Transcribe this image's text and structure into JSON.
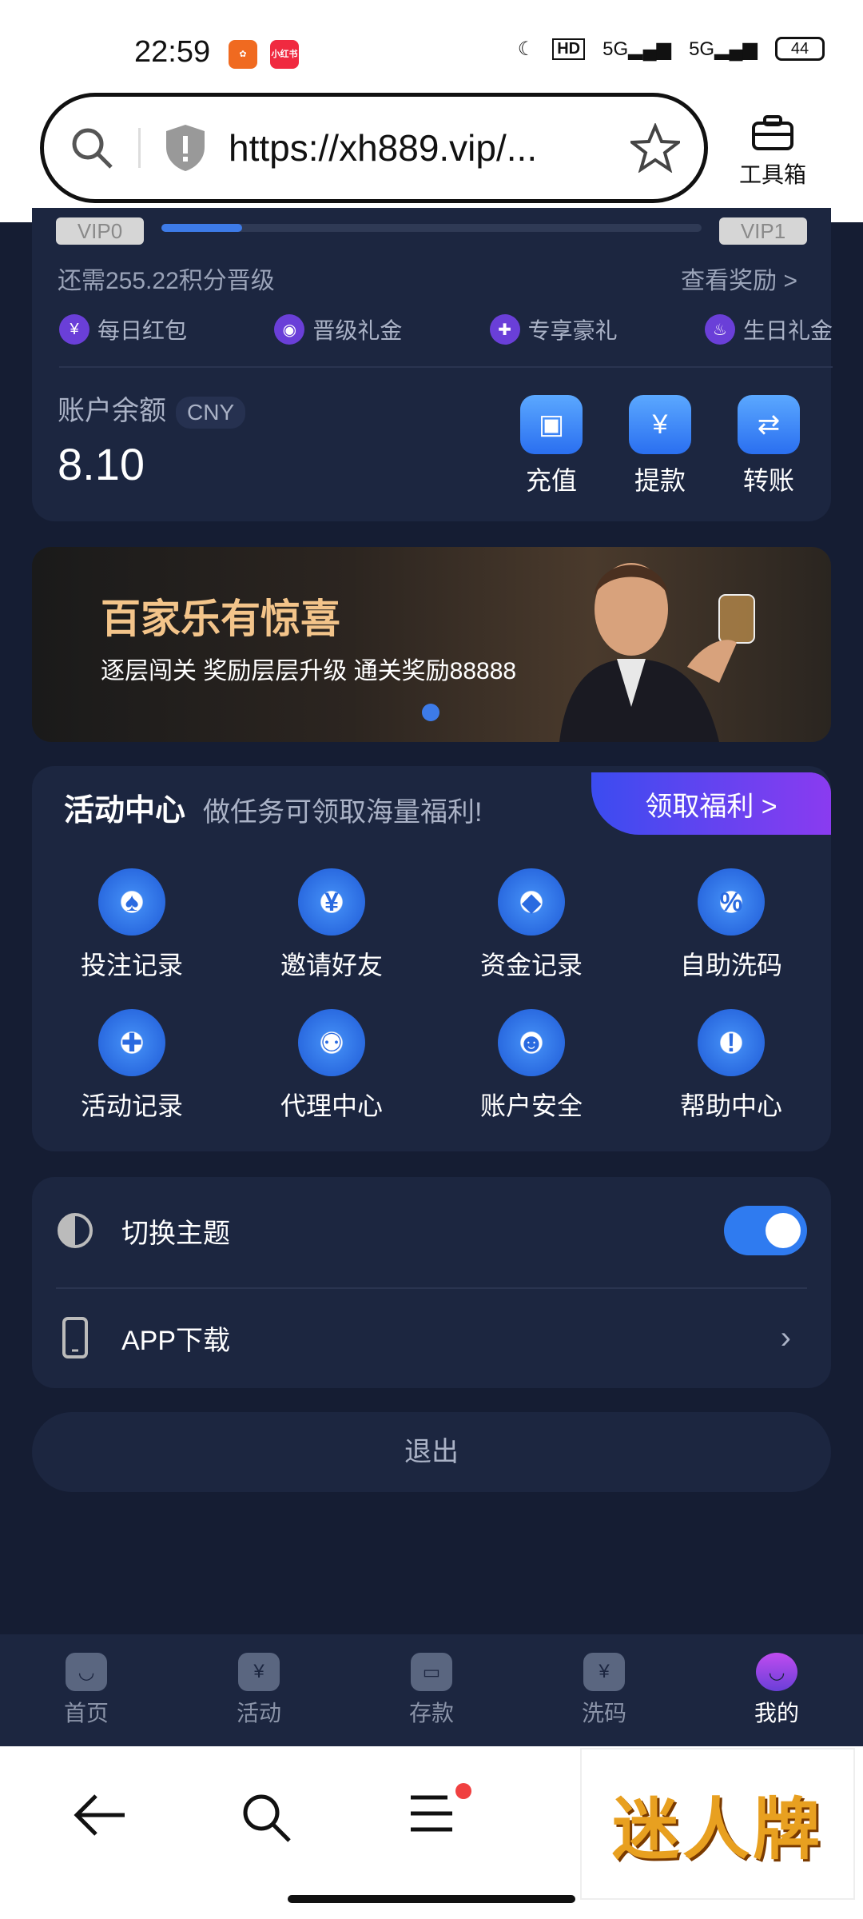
{
  "status": {
    "time": "22:59",
    "app1": "",
    "app2": "小红书",
    "hd": "HD",
    "net1": "5G",
    "net2": "5G",
    "battery": "44"
  },
  "browser": {
    "url": "https://xh889.vip/...",
    "toolbox_label": "工具箱"
  },
  "vip": {
    "from": "VIP0",
    "to": "VIP1",
    "progress": 0.15,
    "need_text": "还需255.22积分晋级",
    "reward_link": "查看奖励 >"
  },
  "perks": [
    {
      "label": "每日红包"
    },
    {
      "label": "晋级礼金"
    },
    {
      "label": "专享豪礼"
    },
    {
      "label": "生日礼金"
    }
  ],
  "balance": {
    "label": "账户余额",
    "currency": "CNY",
    "value": "8.10"
  },
  "actions": [
    {
      "label": "充值"
    },
    {
      "label": "提款"
    },
    {
      "label": "转账"
    }
  ],
  "banner": {
    "title": "百家乐有惊喜",
    "subtitle": "逐层闯关 奖励层层升级 通关奖励88888"
  },
  "activity": {
    "title": "活动中心",
    "subtitle": "做任务可领取海量福利!",
    "claim": "领取福利 >",
    "items": [
      {
        "label": "投注记录"
      },
      {
        "label": "邀请好友"
      },
      {
        "label": "资金记录"
      },
      {
        "label": "自助洗码"
      },
      {
        "label": "活动记录"
      },
      {
        "label": "代理中心"
      },
      {
        "label": "账户安全"
      },
      {
        "label": "帮助中心"
      }
    ]
  },
  "settings": {
    "theme_label": "切换主题",
    "theme_on": true,
    "app_label": "APP下载"
  },
  "logout": "退出",
  "nav": [
    {
      "label": "首页"
    },
    {
      "label": "活动"
    },
    {
      "label": "存款"
    },
    {
      "label": "洗码"
    },
    {
      "label": "我的"
    }
  ],
  "promo": "迷人牌",
  "colors": {
    "bg": "#151d33",
    "card": "#1c2640",
    "accent": "#2f7bf0",
    "purple": "#8a3bf0"
  }
}
